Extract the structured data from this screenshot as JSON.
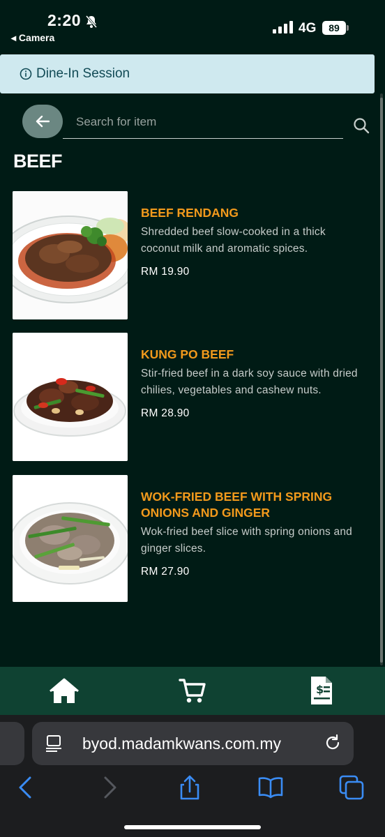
{
  "status": {
    "time": "2:20",
    "back_app": "◂ Camera",
    "network": "4G",
    "battery": "89"
  },
  "session": {
    "label": "Dine-In Session"
  },
  "search": {
    "placeholder": "Search for item"
  },
  "category": {
    "title": "BEEF"
  },
  "items": [
    {
      "name": "BEEF RENDANG",
      "description": "Shredded beef slow-cooked in a thick coconut milk and aromatic spices.",
      "price": "RM 19.90"
    },
    {
      "name": "KUNG PO BEEF",
      "description": "Stir-fried beef in a dark soy sauce with dried chilies, vegetables and cashew nuts.",
      "price": "RM 28.90"
    },
    {
      "name": "WOK-FRIED BEEF WITH SPRING ONIONS AND GINGER",
      "description": "Wok-fried beef slice with spring onions and ginger slices.",
      "price": "RM 27.90"
    }
  ],
  "browser": {
    "url": "byod.madamkwans.com.my"
  },
  "colors": {
    "background": "#001b15",
    "accent": "#f39a1c",
    "nav": "#0f4232",
    "banner": "#cfe9ef"
  },
  "icons": {
    "home": "home-icon",
    "cart": "cart-icon",
    "bill": "bill-icon",
    "search": "search-icon",
    "back": "arrow-left-icon"
  }
}
